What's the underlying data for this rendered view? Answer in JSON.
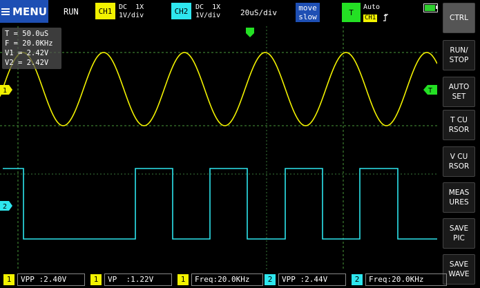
{
  "menu": {
    "label": "MENU",
    "icon": "hamburger-icon"
  },
  "status": {
    "run_state": "RUN",
    "time_div": "20uS/div"
  },
  "ch1": {
    "tag": "CH1",
    "coupling": "DC  1X",
    "volts_div": "1V/div",
    "color": "#f2f200",
    "marker": "1"
  },
  "ch2": {
    "tag": "CH2",
    "coupling": "DC  1X",
    "volts_div": "1V/div",
    "color": "#2ee6ee",
    "marker": "2"
  },
  "move": {
    "line1": "move",
    "line2": "slow"
  },
  "trigger": {
    "tag": "T",
    "mode": "Auto",
    "source": "CH1",
    "edge_icon": "rising-edge-icon",
    "marker": "T",
    "color": "#24e024"
  },
  "battery": {
    "icon": "battery-icon",
    "level": 0.9
  },
  "info": {
    "period": "T = 50.0uS",
    "freq": "F = 20.0KHz",
    "v1": "V1 = 2.42V",
    "v2": "V2 = 2.42V"
  },
  "sidebar": [
    {
      "line1": "CTRL",
      "line2": ""
    },
    {
      "line1": "RUN/",
      "line2": "STOP"
    },
    {
      "line1": "AUTO",
      "line2": "SET"
    },
    {
      "line1": "T CU",
      "line2": "RSOR"
    },
    {
      "line1": "V CU",
      "line2": "RSOR"
    },
    {
      "line1": "MEAS",
      "line2": "URES"
    },
    {
      "line1": "SAVE",
      "line2": "PIC"
    },
    {
      "line1": "SAVE",
      "line2": "WAVE"
    }
  ],
  "measurements": [
    {
      "ch": "1",
      "text": "VPP :2.40V",
      "color": "yellow"
    },
    {
      "ch": "1",
      "text": "VP  :1.22V",
      "color": "yellow"
    },
    {
      "ch": "1",
      "text": "Freq:20.0KHz",
      "color": "yellow"
    },
    {
      "ch": "2",
      "text": "VPP :2.44V",
      "color": "cyan"
    },
    {
      "ch": "2",
      "text": "Freq:20.0KHz",
      "color": "cyan"
    }
  ]
}
